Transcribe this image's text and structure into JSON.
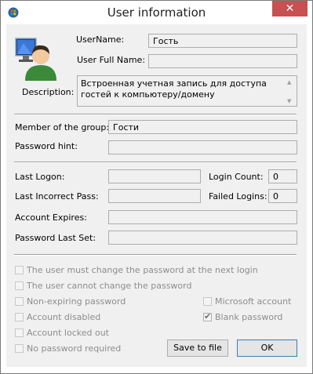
{
  "window": {
    "title": "User information",
    "close_glyph": "✕"
  },
  "labels": {
    "username": "UserName:",
    "full_name": "User Full Name:",
    "description": "Description:",
    "member_group": "Member of the group:",
    "password_hint": "Password hint:",
    "last_logon": "Last Logon:",
    "login_count": "Login Count:",
    "last_incorrect": "Last Incorrect Pass:",
    "failed_logins": "Failed Logins:",
    "account_expires": "Account Expires:",
    "password_last_set": "Password Last Set:"
  },
  "values": {
    "username": "Гость",
    "full_name": "",
    "description": "Встроенная учетная запись для доступа гостей к компьютеру/домену",
    "member_group": "Гости",
    "password_hint": "",
    "last_logon": "",
    "login_count": "0",
    "last_incorrect": "",
    "failed_logins": "0",
    "account_expires": "",
    "password_last_set": ""
  },
  "checkboxes": {
    "must_change": {
      "label": "The user must change the password at the next login",
      "checked": false
    },
    "cannot_change": {
      "label": "The user cannot change the password",
      "checked": false
    },
    "non_expiring": {
      "label": "Non-expiring password",
      "checked": false
    },
    "account_disabled": {
      "label": "Account disabled",
      "checked": false
    },
    "account_locked": {
      "label": "Account locked out",
      "checked": false
    },
    "no_password": {
      "label": "No password required",
      "checked": false
    },
    "microsoft_account": {
      "label": "Microsoft account",
      "checked": false
    },
    "blank_password": {
      "label": "Blank password",
      "checked": true
    }
  },
  "buttons": {
    "save": "Save to file",
    "ok": "OK"
  },
  "icons": {
    "user_avatar": "user-avatar-icon",
    "app": "windows-logo-icon"
  },
  "colors": {
    "close": "#c75050",
    "field_border": "#adadad",
    "client_bg": "#f0f0f0"
  }
}
